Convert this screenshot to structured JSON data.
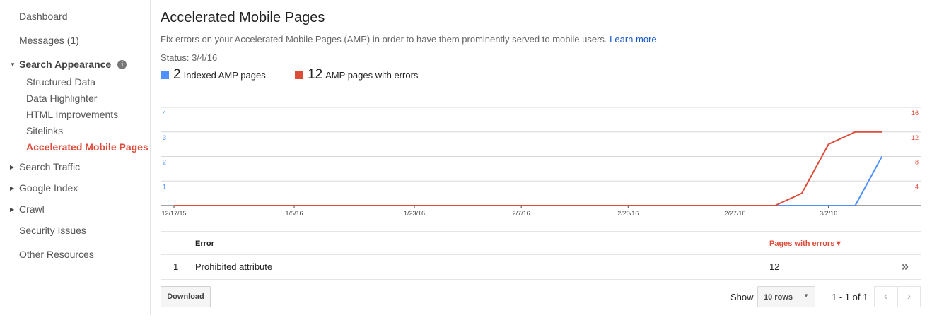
{
  "sidebar": {
    "dashboard": "Dashboard",
    "messages": "Messages (1)",
    "search_appearance": "Search Appearance",
    "sub_items": [
      "Structured Data",
      "Data Highlighter",
      "HTML Improvements",
      "Sitelinks",
      "Accelerated Mobile Pages"
    ],
    "search_traffic": "Search Traffic",
    "google_index": "Google Index",
    "crawl": "Crawl",
    "security_issues": "Security Issues",
    "other_resources": "Other Resources"
  },
  "main": {
    "title": "Accelerated Mobile Pages",
    "description": "Fix errors on your Accelerated Mobile Pages (AMP) in order to have them prominently served to mobile users.",
    "learn_more": "Learn more.",
    "status": "Status: 3/4/16",
    "legend": [
      {
        "value": "2",
        "label": "Indexed AMP pages",
        "color": "#4d90fe"
      },
      {
        "value": "12",
        "label": "AMP pages with errors",
        "color": "#dd4b39"
      }
    ]
  },
  "chart_data": {
    "type": "line",
    "x_tick_labels": [
      "12/17/15",
      "1/5/16",
      "1/23/16",
      "2/7/16",
      "2/20/16",
      "2/27/16",
      "3/2/16"
    ],
    "left_axis_ticks": [
      "1",
      "2",
      "3",
      "4"
    ],
    "right_axis_ticks": [
      "4",
      "8",
      "12",
      "16"
    ],
    "ylim_left": [
      0,
      4
    ],
    "ylim_right": [
      0,
      16
    ],
    "x_range": [
      0,
      55
    ],
    "tick_index": [
      0,
      9,
      18,
      26,
      34,
      42,
      49
    ],
    "series": [
      {
        "color": "#4d90fe",
        "axis": "left",
        "x": [
          0,
          51,
          53
        ],
        "y": [
          0,
          0,
          2
        ]
      },
      {
        "color": "#dd4b39",
        "axis": "right",
        "x": [
          0,
          45,
          47,
          49,
          51,
          53
        ],
        "y": [
          0,
          0,
          2,
          10,
          12,
          12
        ]
      }
    ]
  },
  "table": {
    "header_error": "Error",
    "header_pages": "Pages with errors▼",
    "rows": [
      {
        "index": "1",
        "error": "Prohibited attribute",
        "pages": "12"
      }
    ]
  },
  "footer": {
    "download": "Download",
    "show": "Show",
    "rows_value": "10 rows",
    "pager_text": "1 - 1 of 1"
  }
}
